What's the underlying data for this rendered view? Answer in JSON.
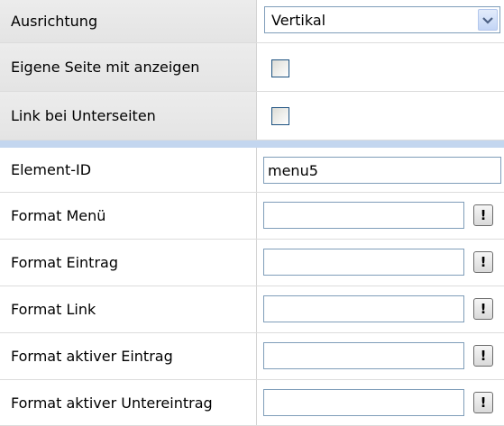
{
  "rows": {
    "ausrichtung": {
      "label": "Ausrichtung",
      "value": "Vertikal"
    },
    "eigene_seite": {
      "label": "Eigene Seite mit anzeigen",
      "checked": false
    },
    "link_unterseiten": {
      "label": "Link bei Unterseiten",
      "checked": false
    },
    "element_id": {
      "label": "Element-ID",
      "value": "menu5"
    },
    "format_menu": {
      "label": "Format Menü",
      "value": "",
      "button": "!"
    },
    "format_eintrag": {
      "label": "Format Eintrag",
      "value": "",
      "button": "!"
    },
    "format_link": {
      "label": "Format Link",
      "value": "",
      "button": "!"
    },
    "format_aktiver_eintrag": {
      "label": "Format aktiver Eintrag",
      "value": "",
      "button": "!"
    },
    "format_aktiver_untereintrag": {
      "label": "Format aktiver Untereintrag",
      "value": "",
      "button": "!"
    }
  },
  "icons": {
    "dropdown": "chevron-down-icon",
    "format": "exclamation-icon"
  },
  "colors": {
    "separator": "#c3d6ef",
    "input_border": "#7f9db9"
  }
}
